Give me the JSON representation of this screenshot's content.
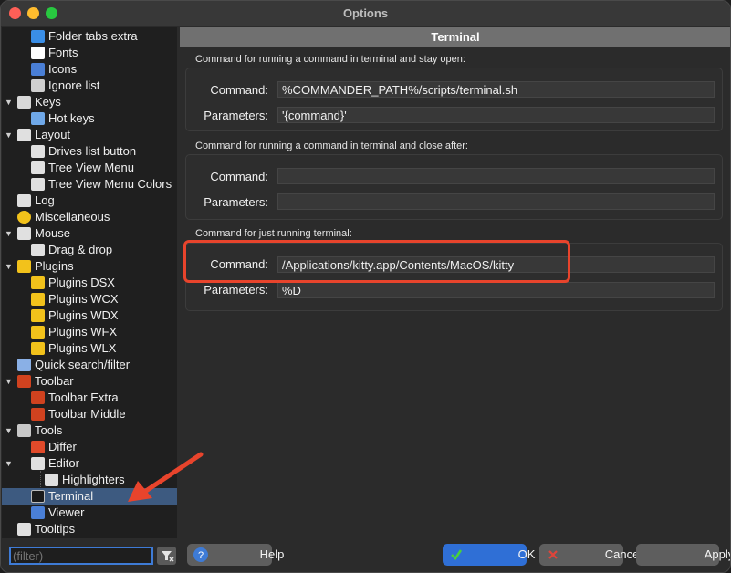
{
  "window": {
    "title": "Options"
  },
  "sidebar": {
    "items": [
      {
        "label": "Folder tabs extra",
        "icon": "folder-tabs-icon",
        "color": "#3a8ee6"
      },
      {
        "label": "Fonts",
        "icon": "fonts-icon",
        "color": "#ffffff"
      },
      {
        "label": "Icons",
        "icon": "icons-icon",
        "color": "#4a7fd6"
      },
      {
        "label": "Ignore list",
        "icon": "ignore-list-icon",
        "color": "#cfcfcf"
      },
      {
        "label": "Keys",
        "icon": "keys-icon",
        "color": "#d8d8d8"
      },
      {
        "label": "Hot keys",
        "icon": "hot-keys-icon",
        "color": "#6fa8e8"
      },
      {
        "label": "Layout",
        "icon": "layout-icon",
        "color": "#e0e0e0"
      },
      {
        "label": "Drives list button",
        "icon": "drives-list-icon",
        "color": "#e0e0e0"
      },
      {
        "label": "Tree View Menu",
        "icon": "tree-view-menu-icon",
        "color": "#e0e0e0"
      },
      {
        "label": "Tree View Menu Colors",
        "icon": "tree-view-colors-icon",
        "color": "#e0e0e0"
      },
      {
        "label": "Log",
        "icon": "log-icon",
        "color": "#e0e0e0"
      },
      {
        "label": "Miscellaneous",
        "icon": "miscellaneous-icon",
        "color": "#f2c21b"
      },
      {
        "label": "Mouse",
        "icon": "mouse-icon",
        "color": "#e0e0e0"
      },
      {
        "label": "Drag & drop",
        "icon": "drag-drop-icon",
        "color": "#e0e0e0"
      },
      {
        "label": "Plugins",
        "icon": "plugin-icon",
        "color": "#f2c21b"
      },
      {
        "label": "Plugins DSX",
        "icon": "plugin-icon",
        "color": "#f2c21b"
      },
      {
        "label": "Plugins WCX",
        "icon": "plugin-icon",
        "color": "#f2c21b"
      },
      {
        "label": "Plugins WDX",
        "icon": "plugin-icon",
        "color": "#f2c21b"
      },
      {
        "label": "Plugins WFX",
        "icon": "plugin-icon",
        "color": "#f2c21b"
      },
      {
        "label": "Plugins WLX",
        "icon": "plugin-icon",
        "color": "#f2c21b"
      },
      {
        "label": "Quick search/filter",
        "icon": "quick-search-icon",
        "color": "#8ab0e6"
      },
      {
        "label": "Toolbar",
        "icon": "toolbar-icon",
        "color": "#d0421f"
      },
      {
        "label": "Toolbar Extra",
        "icon": "toolbar-icon",
        "color": "#d0421f"
      },
      {
        "label": "Toolbar Middle",
        "icon": "toolbar-icon",
        "color": "#d0421f"
      },
      {
        "label": "Tools",
        "icon": "tools-icon",
        "color": "#c8c8c8"
      },
      {
        "label": "Differ",
        "icon": "differ-icon",
        "color": "#e04a2a"
      },
      {
        "label": "Editor",
        "icon": "editor-icon",
        "color": "#e0e0e0"
      },
      {
        "label": "Highlighters",
        "icon": "highlighters-icon",
        "color": "#e0e0e0"
      },
      {
        "label": "Terminal",
        "icon": "terminal-icon",
        "color": "#1a1a1a"
      },
      {
        "label": "Viewer",
        "icon": "viewer-icon",
        "color": "#4a7fd6"
      },
      {
        "label": "Tooltips",
        "icon": "tooltips-icon",
        "color": "#e0e0e0"
      }
    ]
  },
  "panel": {
    "header": "Terminal",
    "groups": [
      {
        "title": "Command for running a command in terminal and stay open:",
        "command_label": "Command:",
        "command_value": "%COMMANDER_PATH%/scripts/terminal.sh",
        "params_label": "Parameters:",
        "params_value": "'{command}'"
      },
      {
        "title": "Command for running a command in terminal and close after:",
        "command_label": "Command:",
        "command_value": "",
        "params_label": "Parameters:",
        "params_value": ""
      },
      {
        "title": "Command for just running terminal:",
        "command_label": "Command:",
        "command_value": "/Applications/kitty.app/Contents/MacOS/kitty",
        "params_label": "Parameters:",
        "params_value": "%D"
      }
    ]
  },
  "bottom": {
    "filter_placeholder": "(filter)",
    "help_label": "Help",
    "ok_label": "OK",
    "cancel_label": "Cancel",
    "apply_label": "Apply"
  },
  "colors": {
    "accent": "#2f6fd6",
    "annotation": "#e8442c",
    "selected": "#3d5a80"
  }
}
